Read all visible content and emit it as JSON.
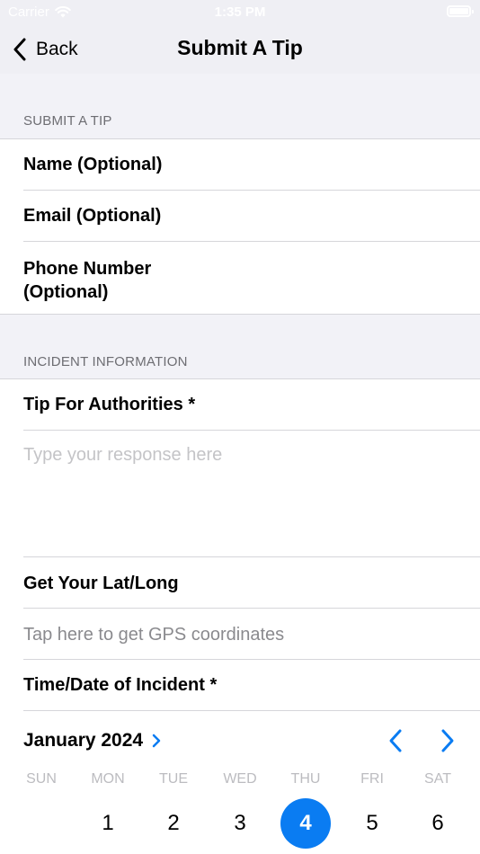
{
  "status_bar": {
    "carrier": "Carrier",
    "time": "1:35 PM"
  },
  "nav": {
    "back_label": "Back",
    "title": "Submit A Tip"
  },
  "sections": {
    "submit": {
      "header": "SUBMIT A TIP",
      "fields": {
        "name": "Name (Optional)",
        "email": "Email (Optional)",
        "phone_line1": "Phone Number",
        "phone_line2": "(Optional)"
      }
    },
    "incident": {
      "header": "INCIDENT INFORMATION",
      "tip_label": "Tip For Authorities *",
      "tip_placeholder": "Type your response here",
      "latlong_label": "Get Your Lat/Long",
      "latlong_hint": "Tap here to get GPS coordinates",
      "datetime_label": "Time/Date of Incident *"
    }
  },
  "calendar": {
    "month_label": "January 2024",
    "weekdays": [
      "SUN",
      "MON",
      "TUE",
      "WED",
      "THU",
      "FRI",
      "SAT"
    ],
    "days": [
      "1",
      "2",
      "3",
      "4",
      "5",
      "6"
    ],
    "selected_day": "4",
    "accent_color": "#0a7cf2"
  },
  "icons": [
    "wifi-icon",
    "battery-icon",
    "chevron-left-icon",
    "chevron-right-icon"
  ]
}
